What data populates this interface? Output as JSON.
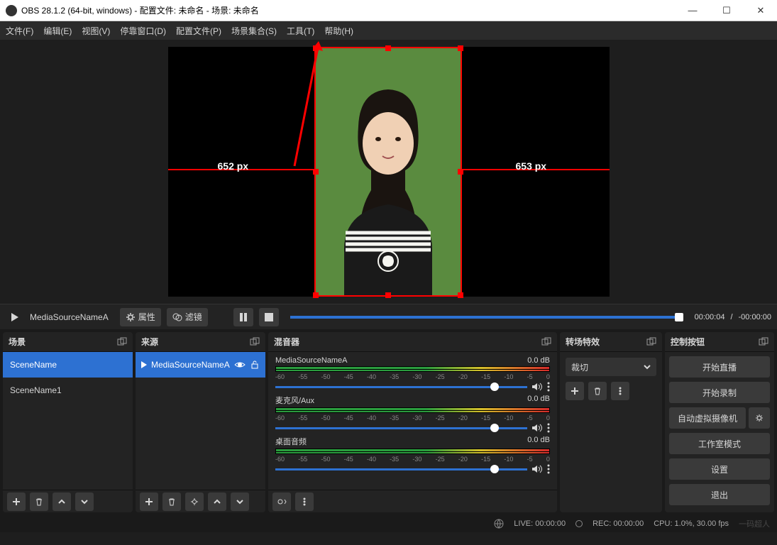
{
  "title": "OBS 28.1.2 (64-bit, windows) - 配置文件: 未命名 - 场景: 未命名",
  "menu": [
    "文件(F)",
    "编辑(E)",
    "视图(V)",
    "停靠窗口(D)",
    "配置文件(P)",
    "场景集合(S)",
    "工具(T)",
    "帮助(H)"
  ],
  "preview": {
    "left_dim": "652 px",
    "right_dim": "653 px"
  },
  "media_bar": {
    "source_name": "MediaSourceNameA",
    "properties_label": "属性",
    "filters_label": "滤镜",
    "elapsed": "00:00:04",
    "sep": "/",
    "remaining": "-00:00:00"
  },
  "docks": {
    "scenes": {
      "title": "场景",
      "items": [
        {
          "name": "SceneName",
          "selected": true
        },
        {
          "name": "SceneName1",
          "selected": false
        }
      ]
    },
    "sources": {
      "title": "来源",
      "items": [
        {
          "name": "MediaSourceNameA",
          "selected": true,
          "visible": true,
          "locked": false
        }
      ]
    },
    "mixer": {
      "title": "混音器",
      "ticks": [
        "-60",
        "-55",
        "-50",
        "-45",
        "-40",
        "-35",
        "-30",
        "-25",
        "-20",
        "-15",
        "-10",
        "-5",
        "0"
      ],
      "channels": [
        {
          "name": "MediaSourceNameA",
          "db": "0.0 dB"
        },
        {
          "name": "麦克风/Aux",
          "db": "0.0 dB"
        },
        {
          "name": "桌面音频",
          "db": "0.0 dB"
        }
      ]
    },
    "transitions": {
      "title": "转场特效",
      "selected": "裁切"
    },
    "controls": {
      "title": "控制按钮",
      "buttons": [
        "开始直播",
        "开始录制",
        "自动虚拟摄像机",
        "工作室模式",
        "设置",
        "退出"
      ]
    }
  },
  "status": {
    "live": "LIVE: 00:00:00",
    "rec": "REC: 00:00:00",
    "cpu": "CPU: 1.0%, 30.00 fps"
  },
  "watermark": "一码超人"
}
